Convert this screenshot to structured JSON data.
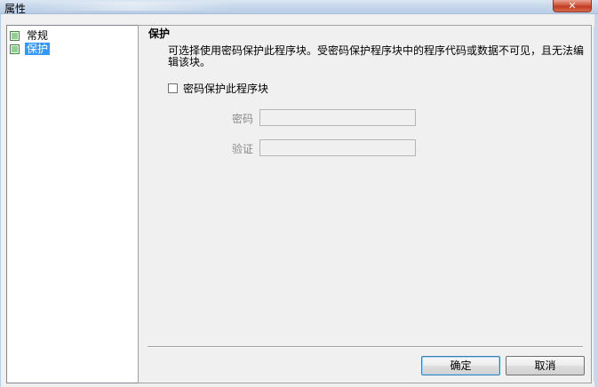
{
  "window": {
    "title": "属性",
    "close_symbol": "✕"
  },
  "tree": {
    "items": [
      {
        "label": "常规",
        "icon": "green-square-icon",
        "selected": false
      },
      {
        "label": "保护",
        "icon": "green-square-icon",
        "selected": true
      }
    ]
  },
  "panel": {
    "section_title": "保护",
    "description": "可选择使用密码保护此程序块。受密码保护程序块中的程序代码或数据不可见，且无法编辑该块。",
    "checkbox_label": "密码保护此程序块",
    "checkbox_checked": false,
    "password": {
      "label": "密码",
      "value": ""
    },
    "confirm": {
      "label": "验证",
      "value": ""
    }
  },
  "buttons": {
    "ok": "确定",
    "cancel": "取消"
  },
  "colors": {
    "selection": "#3399ff",
    "close_button": "#c13a20",
    "titlebar": "#c6d7ea"
  }
}
